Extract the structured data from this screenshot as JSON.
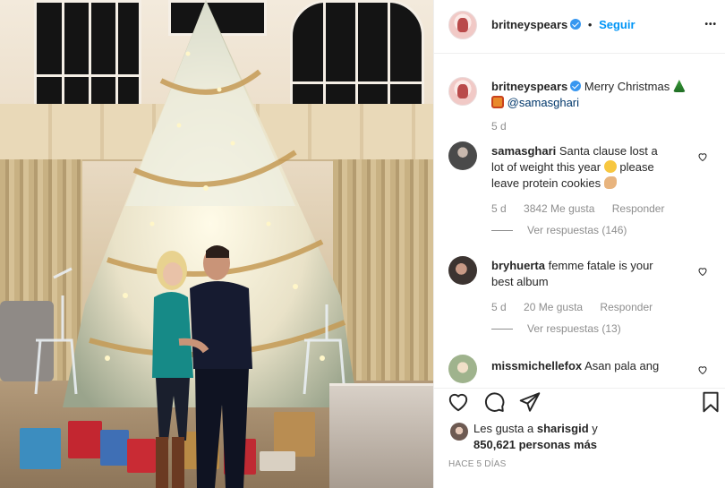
{
  "header": {
    "username": "britneyspears",
    "separator": "•",
    "follow_label": "Seguir",
    "more_label": "•••"
  },
  "caption": {
    "username": "britneyspears",
    "text": "Merry Christmas",
    "mention": "@samasghari",
    "time": "5 d",
    "emojis": [
      "christmas-tree",
      "gift"
    ]
  },
  "comments": [
    {
      "username": "samasghari",
      "text_1": "Santa clause lost a",
      "text_2": "lot of weight this year",
      "text_3": "please",
      "text_4": "leave protein cookies",
      "time": "5 d",
      "likes": "3842 Me gusta",
      "reply_label": "Responder",
      "view_replies": "Ver respuestas (146)"
    },
    {
      "username": "bryhuerta",
      "text_1": "femme fatale is your",
      "text_2": "best album",
      "time": "5 d",
      "likes": "20 Me gusta",
      "reply_label": "Responder",
      "view_replies": "Ver respuestas (13)"
    },
    {
      "username": "missmichellefox",
      "text_1": "Asan pala ang"
    }
  ],
  "likes": {
    "prefix": "Les gusta a",
    "user": "sharisgid",
    "mid": "y",
    "count": "850,621 personas más"
  },
  "timestamp": "HACE 5 DÍAS",
  "colors": {
    "accent": "#0095f6",
    "verified": "#3897f0",
    "muted": "#8e8e8e"
  },
  "icons": [
    "heart-icon",
    "comment-icon",
    "share-icon",
    "bookmark-icon",
    "verified-badge-icon"
  ]
}
